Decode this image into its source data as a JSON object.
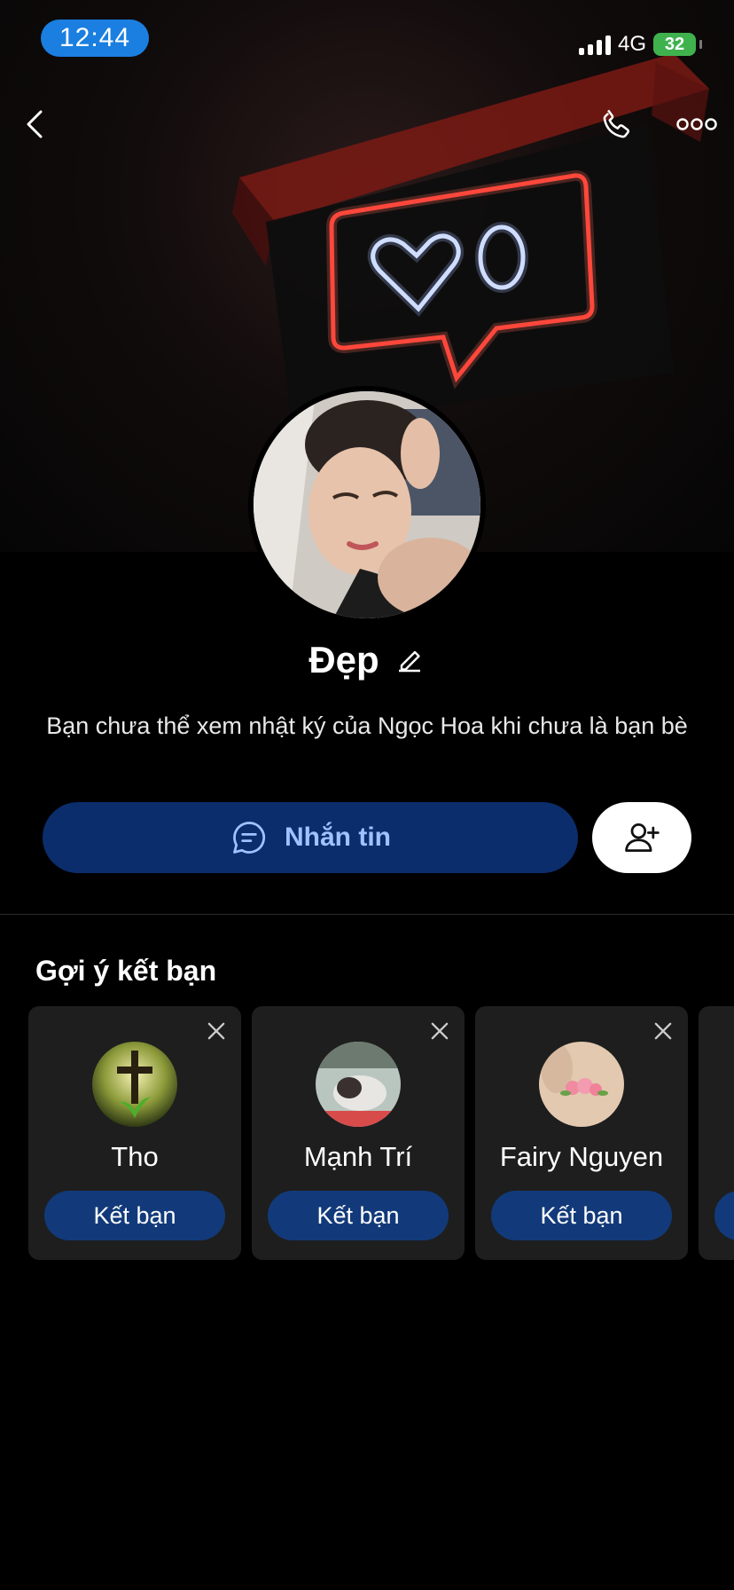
{
  "status_bar": {
    "time": "12:44",
    "network": "4G",
    "battery": "32"
  },
  "profile": {
    "name": "Đẹp",
    "notice": "Bạn chưa thể xem nhật ký của Ngọc Hoa khi chưa là bạn bè",
    "message_button": "Nhắn tin"
  },
  "suggestions": {
    "title": "Gợi ý kết bạn",
    "items": [
      {
        "name": "Tho",
        "button": "Kết bạn"
      },
      {
        "name": "Mạnh Trí",
        "button": "Kết bạn"
      },
      {
        "name": "Fairy Nguyen",
        "button": "Kết bạn"
      }
    ]
  },
  "colors": {
    "accent": "#1a7fe0",
    "message_button_bg": "#0b2d6b",
    "friend_button_bg": "#123a7a",
    "battery": "#3fb24e",
    "neon_red": "#ff3b30"
  }
}
